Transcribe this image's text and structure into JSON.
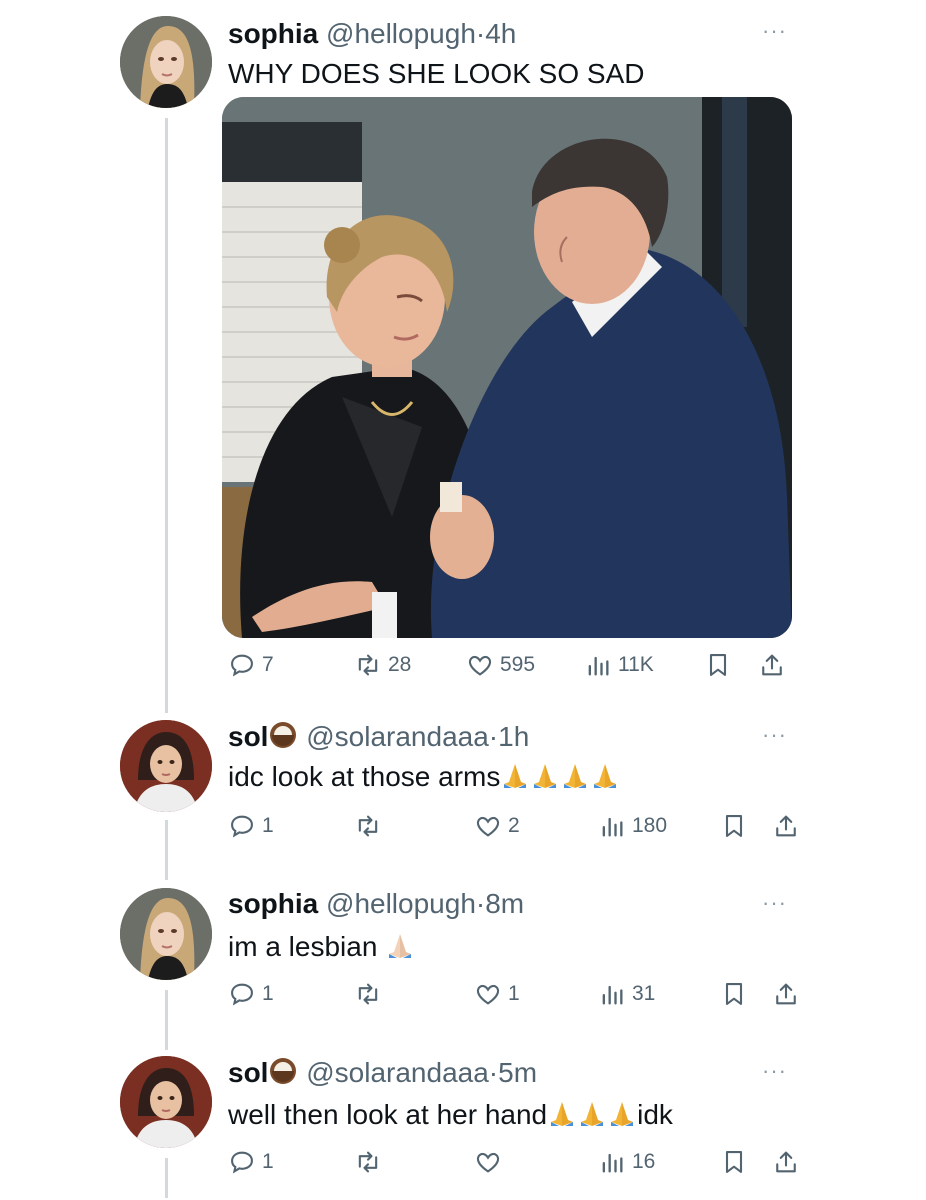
{
  "tweets": [
    {
      "name": "sophia",
      "handle": "@hellopugh",
      "time": "4h",
      "text": "WHY DOES SHE LOOK SO SAD",
      "reply_count": "7",
      "retweet_count": "28",
      "like_count": "595",
      "view_count": "11K"
    },
    {
      "name": "sol",
      "handle": "@solarandaaa",
      "time": "1h",
      "text": "idc look at those arms",
      "reply_count": "1",
      "retweet_count": "",
      "like_count": "2",
      "view_count": "180"
    },
    {
      "name": "sophia",
      "handle": "@hellopugh",
      "time": "8m",
      "text": "im a lesbian",
      "reply_count": "1",
      "retweet_count": "",
      "like_count": "1",
      "view_count": "31"
    },
    {
      "name": "sol",
      "handle": "@solarandaaa",
      "time": "5m",
      "text": "well then look at her hand",
      "text_suffix": "idk",
      "reply_count": "1",
      "retweet_count": "",
      "like_count": "",
      "view_count": "16"
    }
  ],
  "separator": "·",
  "more_label": "···",
  "icons": {
    "reply": "speech-bubble-icon",
    "retweet": "retweet-arrows-icon",
    "like": "heart-icon",
    "views": "bar-chart-icon",
    "bookmark": "bookmark-icon",
    "share": "share-upload-icon",
    "coconut": "coconut-emoji",
    "pray": "folded-hands-emoji"
  },
  "colors": {
    "text": "#0f1419",
    "secondary": "#536471",
    "thread_line": "#cfd9de",
    "suit": "#23375f"
  }
}
